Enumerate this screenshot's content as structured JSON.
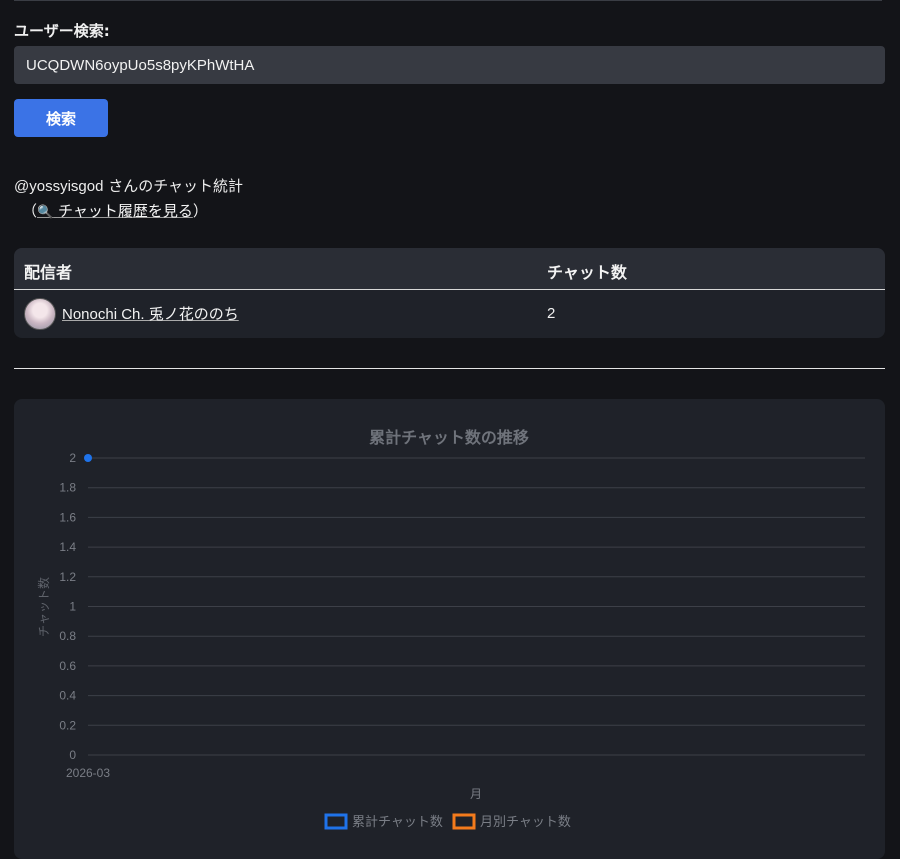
{
  "search": {
    "label": "ユーザー検索:",
    "value": "UCQDWN6oypUo5s8pyKPhWtHA",
    "button_label": "検索"
  },
  "stats": {
    "user_handle": "@yossyisgod",
    "title_suffix": " さんのチャット統計",
    "paren_open": "（",
    "magnifier": "🔍",
    "history_link": "チャット履歴を見る",
    "paren_close": "）"
  },
  "table": {
    "headers": [
      "配信者",
      "チャット数"
    ],
    "rows": [
      {
        "streamer": "Nonochi Ch. 兎ノ花ののち",
        "count": "2"
      }
    ]
  },
  "colors": {
    "accent": "#3b73e6",
    "series_cumulative": "#1f73ea",
    "series_monthly": "#f47b1c"
  },
  "chart_data": {
    "type": "line",
    "title": "累計チャット数の推移",
    "xlabel": "月",
    "ylabel": "チャット数",
    "categories": [
      "2026-03"
    ],
    "ylim": [
      0,
      2
    ],
    "yticks": [
      "0",
      "0.2",
      "0.4",
      "0.6",
      "0.8",
      "1",
      "1.2",
      "1.4",
      "1.6",
      "1.8",
      "2"
    ],
    "series": [
      {
        "name": "累計チャット数",
        "values": [
          2
        ]
      },
      {
        "name": "月別チャット数",
        "values": []
      }
    ],
    "grid": true,
    "legend": "bottom"
  }
}
